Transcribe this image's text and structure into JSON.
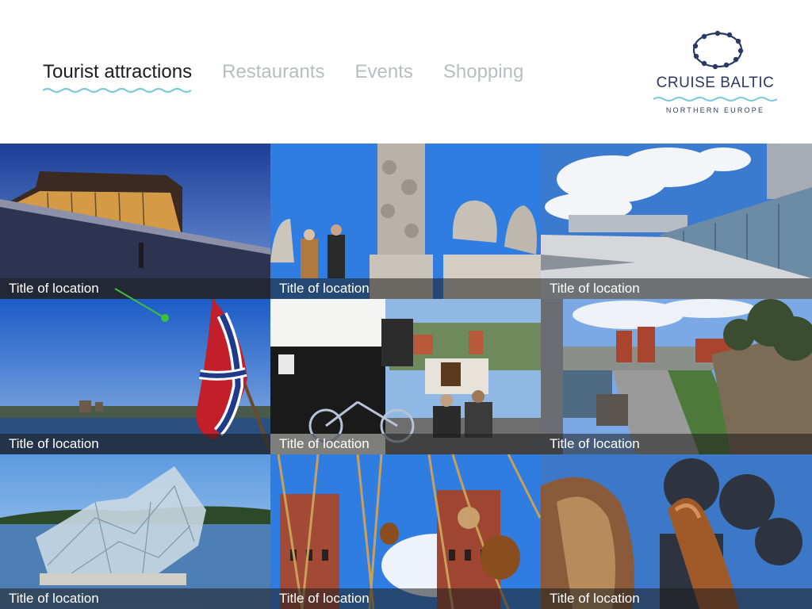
{
  "nav": {
    "tabs": [
      {
        "label": "Tourist attractions",
        "active": true
      },
      {
        "label": "Restaurants",
        "active": false
      },
      {
        "label": "Events",
        "active": false
      },
      {
        "label": "Shopping",
        "active": false
      }
    ]
  },
  "logo": {
    "title": "CRUISE BALTIC",
    "subtitle": "NORTHERN EUROPE"
  },
  "tiles": [
    {
      "title": "Title of location"
    },
    {
      "title": "Title of location"
    },
    {
      "title": "Title of location"
    },
    {
      "title": "Title of location"
    },
    {
      "title": "Title of location"
    },
    {
      "title": "Title of location"
    },
    {
      "title": "Title of location"
    },
    {
      "title": "Title of location"
    },
    {
      "title": "Title of location"
    }
  ],
  "colors": {
    "accent_wave": "#7ec8d8",
    "brand_navy": "#2b3a63",
    "active_tab": "#1d1d1f",
    "inactive_tab": "#b9bcc0",
    "pointer": "#3fbf3f"
  }
}
